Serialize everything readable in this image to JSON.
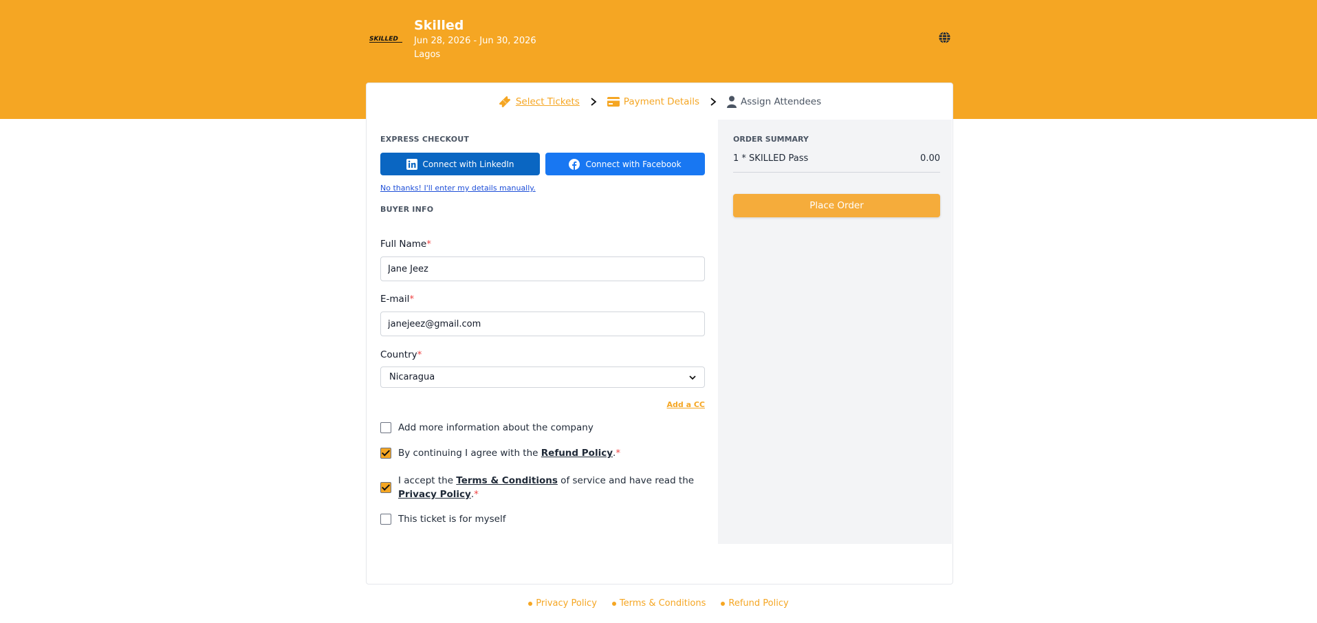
{
  "event": {
    "title": "Skilled",
    "dates": "Jun 28, 2026 - Jun 30, 2026",
    "city": "Lagos",
    "logo_text": "SKILLED"
  },
  "steps": [
    {
      "label": "Select Tickets",
      "icon": "ticket-icon"
    },
    {
      "label": "Payment Details",
      "icon": "credit-card-icon"
    },
    {
      "label": "Assign Attendees",
      "icon": "user-icon"
    }
  ],
  "express": {
    "label": "EXPRESS CHECKOUT",
    "linkedin": "Connect with LinkedIn",
    "facebook": "Connect with Facebook",
    "manual": "No thanks! I'll enter my details manually."
  },
  "buyer": {
    "label": "BUYER INFO",
    "name_label": "Full Name",
    "name_value": "Jane Jeez",
    "email_label": "E-mail",
    "email_value": "janejeez@gmail.com",
    "country_label": "Country",
    "country_value": "Nicaragua",
    "add_cc": "Add a CC",
    "required_mark": "*"
  },
  "checks": {
    "company": {
      "text": "Add more information about the company",
      "checked": false
    },
    "refund": {
      "pre": "By continuing I agree with the ",
      "link": "Refund Policy",
      "post": ".",
      "checked": true
    },
    "terms": {
      "pre": "I accept the ",
      "link1": "Terms & Conditions",
      "mid": " of service and have read the ",
      "link2": "Privacy Policy",
      "post": ".",
      "checked": true
    },
    "myself": {
      "text": "This ticket is for myself",
      "checked": false
    }
  },
  "summary": {
    "label": "ORDER SUMMARY",
    "item": "1 * SKILLED Pass",
    "amount": "0.00",
    "place_order": "Place Order"
  },
  "footer": {
    "links": [
      "Privacy Policy",
      "Terms & Conditions",
      "Refund Policy"
    ]
  },
  "colors": {
    "brand": "#f5a623",
    "linkedin": "#0a66c2",
    "facebook": "#1877f2"
  }
}
